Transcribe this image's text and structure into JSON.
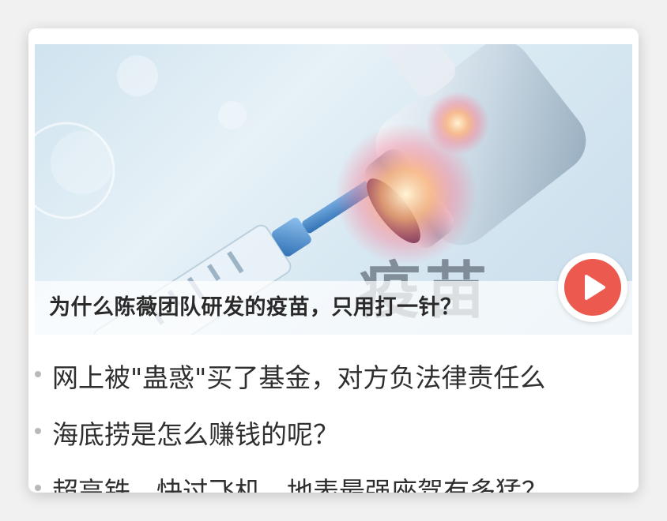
{
  "feature": {
    "caption": "为什么陈薇团队研发的疫苗，只用打一针？",
    "image_watermark": "疫苗",
    "play_icon": "play-icon"
  },
  "news": [
    {
      "title": "网上被\"蛊惑\"买了基金，对方负法律责任么"
    },
    {
      "title": "海底捞是怎么赚钱的呢？"
    },
    {
      "title": "超高铁，快过飞机，地表最强座驾有多猛？"
    }
  ],
  "colors": {
    "play_button": "#ec5a4f",
    "caption_text": "#2a2a2a",
    "news_text": "#2f2f2f"
  }
}
